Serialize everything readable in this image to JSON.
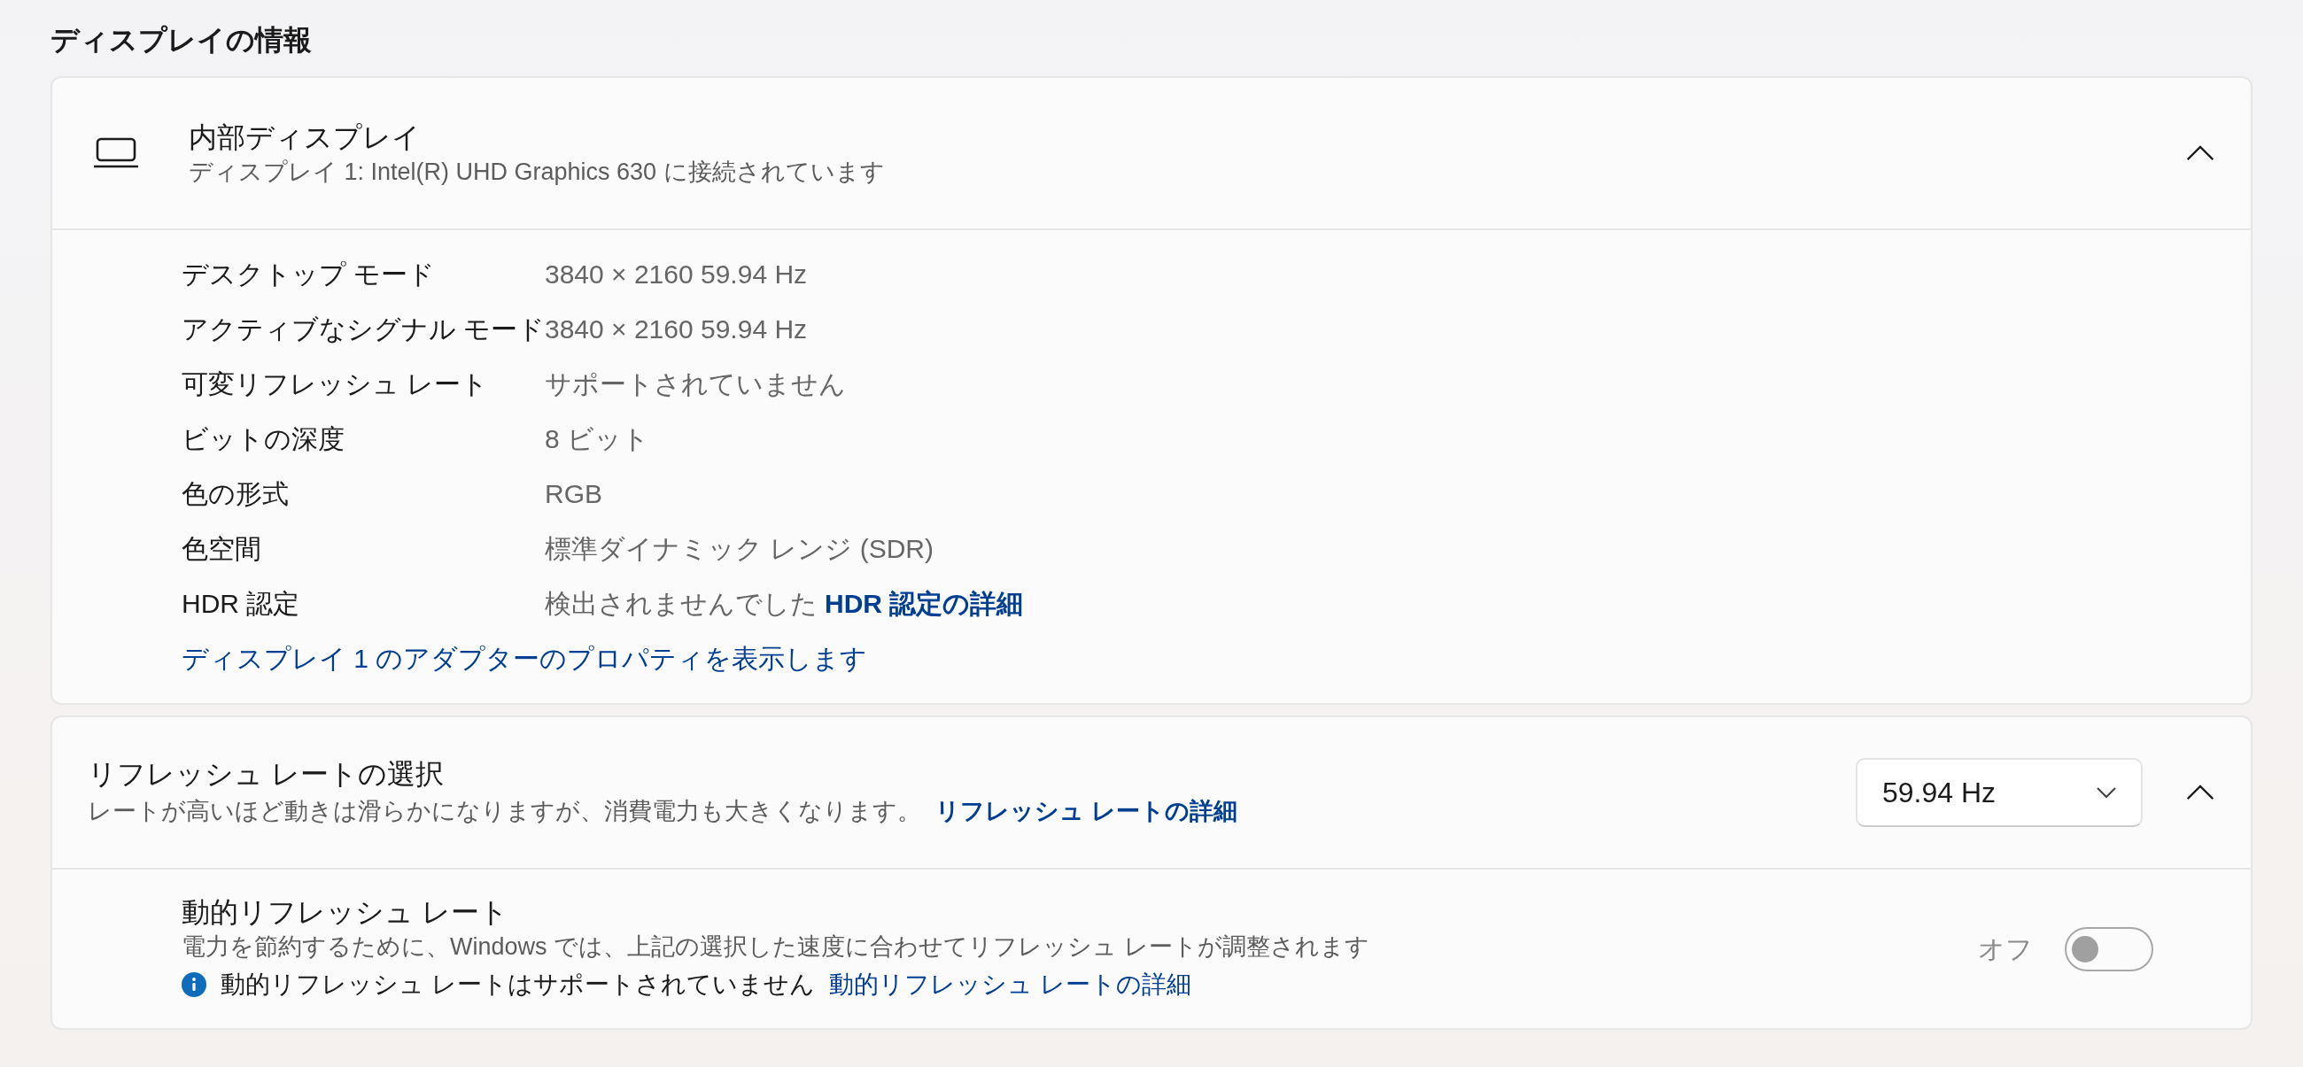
{
  "section_title": "ディスプレイの情報",
  "display_card": {
    "title": "内部ディスプレイ",
    "subtitle": "ディスプレイ 1: Intel(R) UHD Graphics 630 に接続されています",
    "expanded": true,
    "properties": [
      {
        "label": "デスクトップ モード",
        "value": "3840 × 2160 59.94 Hz"
      },
      {
        "label": "アクティブなシグナル モード",
        "value": "3840 × 2160 59.94 Hz"
      },
      {
        "label": "可変リフレッシュ レート",
        "value": "サポートされていません"
      },
      {
        "label": "ビットの深度",
        "value": "8 ビット"
      },
      {
        "label": "色の形式",
        "value": "RGB"
      },
      {
        "label": "色空間",
        "value": "標準ダイナミック レンジ (SDR)"
      },
      {
        "label": "HDR 認定",
        "value": "検出されませんでした",
        "link": "HDR 認定の詳細"
      }
    ],
    "adapter_link": "ディスプレイ 1 のアダプターのプロパティを表示します"
  },
  "refresh_card": {
    "title": "リフレッシュ レートの選択",
    "description": "レートが高いほど動きは滑らかになりますが、消費電力も大きくなります。",
    "link": "リフレッシュ レートの詳細",
    "dropdown": {
      "value": "59.94 Hz"
    },
    "expanded": true,
    "dynamic": {
      "title": "動的リフレッシュ レート",
      "description": "電力を節約するために、Windows では、上記の選択した速度に合わせてリフレッシュ レートが調整されます",
      "toggle_label": "オフ",
      "on": false,
      "notice": "動的リフレッシュ レートはサポートされていません",
      "notice_link": "動的リフレッシュ レートの詳細"
    }
  }
}
